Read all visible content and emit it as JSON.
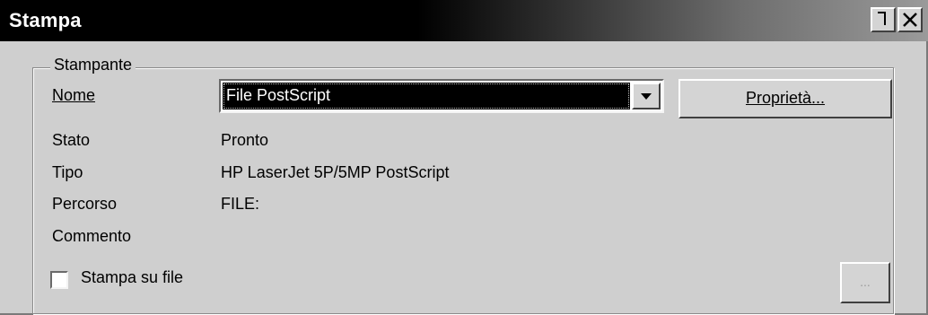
{
  "window": {
    "title": "Stampa",
    "buttons": {
      "help": "?",
      "close": "×"
    }
  },
  "printer_group": {
    "legend": "Stampante",
    "name_label": "Nome",
    "name_value": "File PostScript",
    "properties_button": "Proprietà...",
    "fields": [
      {
        "label": "Stato",
        "value": "Pronto"
      },
      {
        "label": "Tipo",
        "value": "HP LaserJet 5P/5MP PostScript"
      },
      {
        "label": "Percorso",
        "value": "FILE:"
      },
      {
        "label": "Commento",
        "value": ""
      }
    ],
    "print_to_file_label": "Stampa su file",
    "print_to_file_checked": false,
    "browse_button": "..."
  }
}
